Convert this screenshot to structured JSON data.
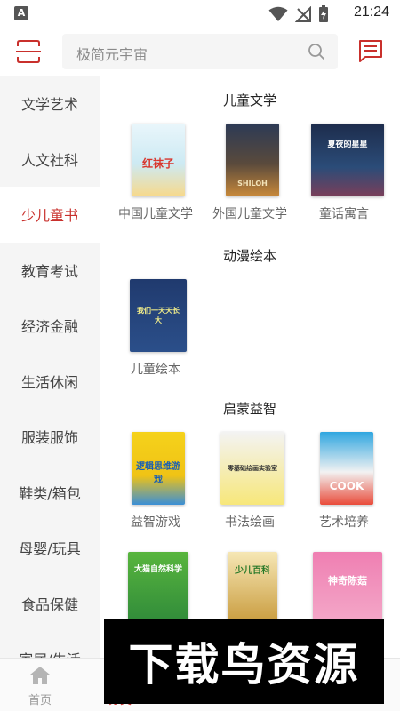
{
  "status_bar": {
    "time": "21:24",
    "app_badge": "A"
  },
  "header": {
    "search_placeholder": "极简元宇宙"
  },
  "sidebar": {
    "items": [
      {
        "label": "文学艺术"
      },
      {
        "label": "人文社科"
      },
      {
        "label": "少儿童书",
        "active": true
      },
      {
        "label": "教育考试"
      },
      {
        "label": "经济金融"
      },
      {
        "label": "生活休闲"
      },
      {
        "label": "服装服饰"
      },
      {
        "label": "鞋类/箱包"
      },
      {
        "label": "母婴/玩具"
      },
      {
        "label": "食品保健"
      },
      {
        "label": "家居/生活"
      }
    ]
  },
  "sections": [
    {
      "title": "儿童文学",
      "items": [
        {
          "label": "中国儿童文学",
          "cover_text": "红袜子"
        },
        {
          "label": "外国儿童文学",
          "cover_text": "SHILOH"
        },
        {
          "label": "童话寓言",
          "cover_text": "夏夜的星星"
        }
      ]
    },
    {
      "title": "动漫绘本",
      "items": [
        {
          "label": "儿童绘本",
          "cover_text": "我们一天天长大"
        }
      ]
    },
    {
      "title": "启蒙益智",
      "items": [
        {
          "label": "益智游戏",
          "cover_text": "逻辑思维游戏"
        },
        {
          "label": "书法绘画",
          "cover_text": "零基础绘画实验室"
        },
        {
          "label": "艺术培养",
          "cover_text": "COOK"
        },
        {
          "label": "",
          "cover_text": "大猫自然科学"
        },
        {
          "label": "",
          "cover_text": "少儿百科"
        },
        {
          "label": "",
          "cover_text": "神奇陈菇"
        }
      ]
    }
  ],
  "bottom_nav": {
    "items": [
      {
        "label": "首页",
        "icon": "home-icon"
      },
      {
        "label": "分类",
        "icon": "category-icon",
        "active": true
      },
      {
        "label": "",
        "icon": "discover-icon"
      },
      {
        "label": "",
        "icon": "cart-icon"
      },
      {
        "label": "",
        "icon": "profile-icon"
      }
    ]
  },
  "watermark": {
    "text": "下载鸟资源"
  },
  "colors": {
    "accent": "#c9302c",
    "sidebar_bg": "#f5f5f5",
    "text": "#444444"
  }
}
